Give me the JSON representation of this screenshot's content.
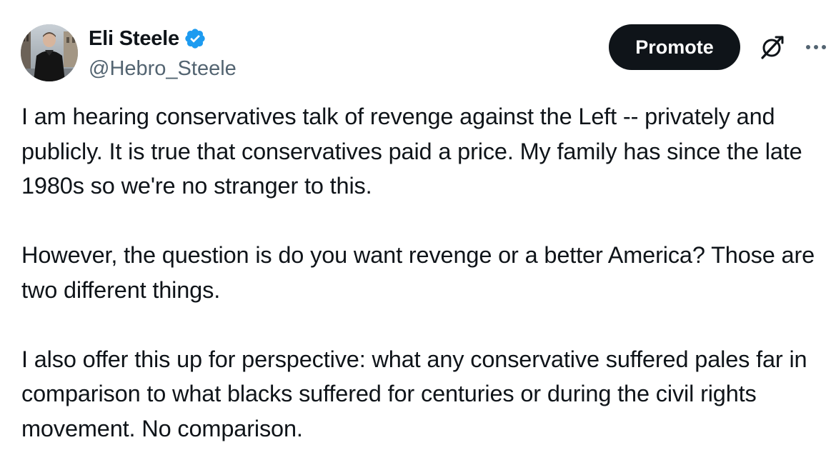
{
  "post": {
    "author": {
      "display_name": "Eli Steele",
      "handle": "@Hebro_Steele",
      "verified": true,
      "verified_color": "#1d9bf0"
    },
    "actions": {
      "promote_label": "Promote",
      "grok_icon": "grok-icon",
      "more_icon": "more-icon"
    },
    "body": {
      "paragraphs": [
        "I am hearing conservatives talk of revenge against the Left -- privately and publicly. It is true that conservatives paid a price. My family has since the late 1980s so we're no stranger to this.",
        "However, the question is do you want revenge or a better America? Those are two different things.",
        "I also offer this up for perspective: what any conservative suffered pales far in comparison to what blacks suffered for centuries or during the civil rights movement. No comparison."
      ]
    }
  },
  "colors": {
    "text_primary": "#0f1419",
    "text_secondary": "#536471",
    "button_bg": "#0f1419",
    "background": "#ffffff"
  }
}
